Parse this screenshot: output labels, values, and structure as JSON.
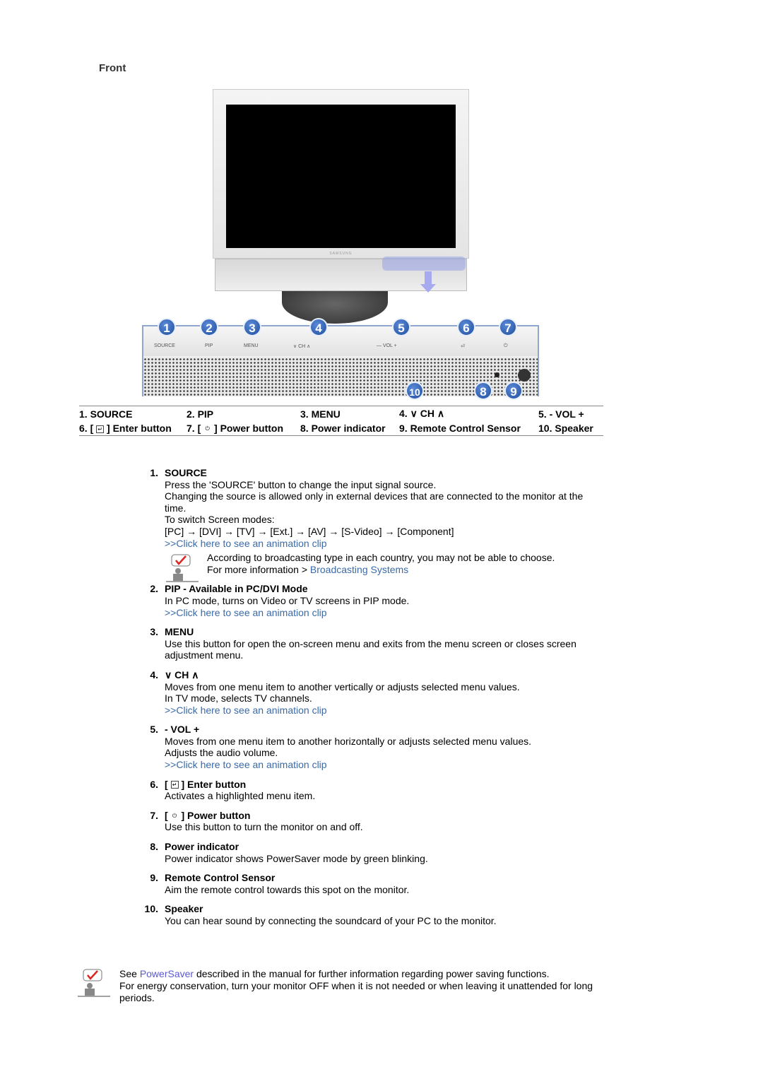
{
  "section_title": "Front",
  "monitor": {
    "brand": "SAMSUNG",
    "panel_labels": [
      "SOURCE",
      "PIP",
      "MENU",
      "∨  CH  ∧",
      "—  VOL  +",
      "⏎",
      "⏻"
    ],
    "badges": [
      "1",
      "2",
      "3",
      "4",
      "5",
      "6",
      "7",
      "10",
      "8",
      "9"
    ]
  },
  "legend": {
    "rows": [
      [
        "1. SOURCE",
        "2. PIP",
        "3. MENU",
        "4. ∨ CH ∧",
        "5. - VOL +"
      ],
      [
        "6. [ ⏎ ] Enter button",
        "7. [ ⏻ ] Power button",
        "8. Power indicator",
        "9. Remote Control Sensor",
        "10. Speaker"
      ]
    ],
    "enter_prefix": "6. [",
    "enter_suffix": "] Enter button",
    "power_prefix": "7. [",
    "power_suffix": "] Power button"
  },
  "items": [
    {
      "num": "1.",
      "title": "SOURCE",
      "lines": [
        "Press the 'SOURCE' button to change the input signal source.",
        "Changing the source is allowed only in external devices that are connected to the monitor at the time.",
        "To switch Screen modes:",
        "[PC] → [DVI] → [TV] → [Ext.] → [AV] → [S-Video] → [Component]"
      ],
      "link": ">>Click here to see an animation clip",
      "note": {
        "line1": "According to broadcasting type in each country, you may not be able to choose.",
        "line2_prefix": "For more information > ",
        "line2_link": "Broadcasting Systems"
      }
    },
    {
      "num": "2.",
      "title": "PIP - Available in PC/DVI Mode",
      "lines": [
        "In PC mode, turns on Video or TV screens in PIP mode."
      ],
      "link": ">>Click here to see an animation clip"
    },
    {
      "num": "3.",
      "title": "MENU",
      "lines": [
        "Use this button for open the on-screen menu and exits from the menu screen or closes screen adjustment menu."
      ]
    },
    {
      "num": "4.",
      "title": "∨ CH ∧",
      "lines": [
        "Moves from one menu item to another vertically or adjusts selected menu values.",
        "In TV mode, selects TV channels."
      ],
      "link": ">>Click here to see an animation clip"
    },
    {
      "num": "5.",
      "title": "- VOL +",
      "lines": [
        "Moves from one menu item to another horizontally or adjusts selected menu values.",
        "Adjusts the audio volume."
      ],
      "link": ">>Click here to see an animation clip"
    },
    {
      "num": "6.",
      "title_prefix": "[",
      "title_suffix": "] Enter button",
      "lines": [
        "Activates a highlighted menu item."
      ]
    },
    {
      "num": "7.",
      "title_prefix": "[",
      "title_suffix": "] Power button",
      "lines": [
        "Use this button to turn the monitor on and off."
      ]
    },
    {
      "num": "8.",
      "title": "Power indicator",
      "lines": [
        "Power indicator shows PowerSaver mode by green blinking."
      ]
    },
    {
      "num": "9.",
      "title": "Remote Control Sensor",
      "lines": [
        "Aim the remote control towards this spot on the monitor."
      ]
    },
    {
      "num": "10.",
      "title": "Speaker",
      "lines": [
        "You can hear sound by connecting the soundcard of your PC to the monitor."
      ]
    }
  ],
  "footer": {
    "prefix": "See ",
    "link": "PowerSaver",
    "suffix": " described in the manual for further information regarding power saving functions.",
    "line2": "For energy conservation, turn your monitor OFF when it is not needed or when leaving it unattended for long periods."
  },
  "colors": {
    "link": "#3a6aa8",
    "badge": "#2b5eb0",
    "highlight": "#a8aaf0"
  }
}
